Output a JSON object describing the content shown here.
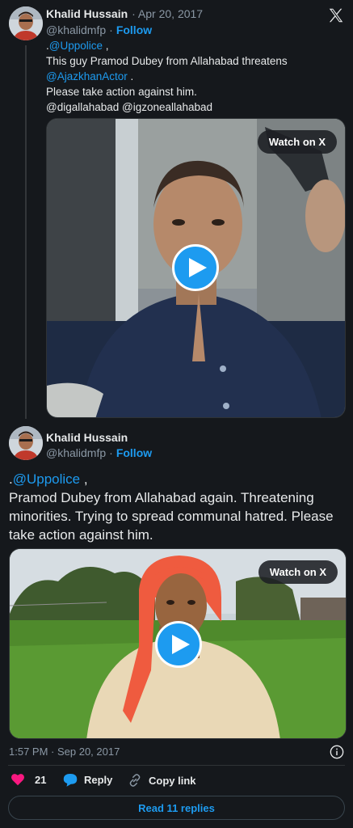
{
  "tweet1": {
    "name": "Khalid Hussain",
    "date": "· Apr 20, 2017",
    "handle": "@khalidmfp",
    "dot": "·",
    "follow": "Follow",
    "line1_prefix": ".",
    "line1_mention": "@Uppolice",
    "line1_suffix": " ,",
    "line2": "This guy Pramod Dubey from Allahabad threatens",
    "line3_mention": "@AjazkhanActor",
    "line3_suffix": " .",
    "line4": "Please take action against him.",
    "line5": "@digallahabad  @igzoneallahabad",
    "watch_label": "Watch on X"
  },
  "tweet2": {
    "name": "Khalid Hussain",
    "handle": "@khalidmfp",
    "dot": "·",
    "follow": "Follow",
    "line1_prefix": ".",
    "line1_mention": "@Uppolice",
    "line1_suffix": " ,",
    "body": "Pramod Dubey from Allahabad again. Threatening minorities. Trying to spread communal hatred. Please take action against him.",
    "watch_label": "Watch on X",
    "timestamp": "1:57 PM · Sep 20, 2017"
  },
  "actions": {
    "like_count": "21",
    "reply_label": "Reply",
    "copy_link_label": "Copy link"
  },
  "read_replies_label": "Read 11 replies",
  "colors": {
    "background": "#15181c",
    "accent": "#1d9bf0",
    "like": "#f91880"
  }
}
